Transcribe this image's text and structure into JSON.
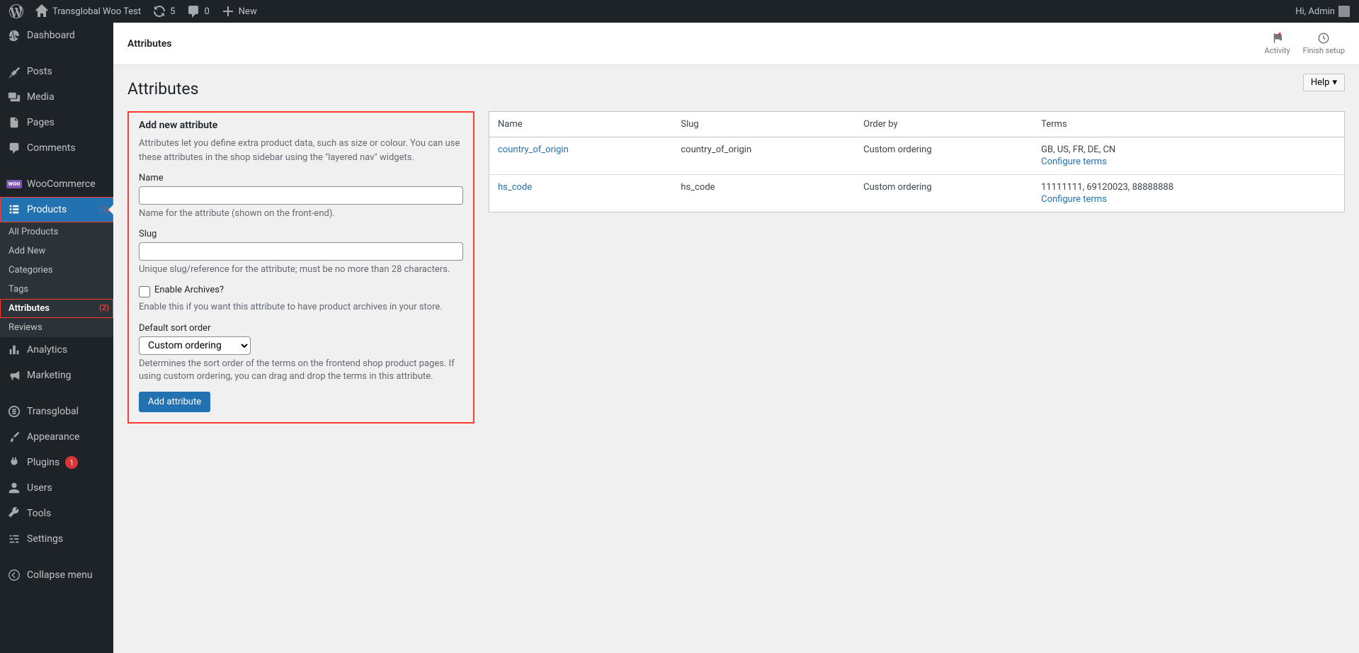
{
  "toolbar": {
    "site_name": "Transglobal Woo Test",
    "updates": "5",
    "comments": "0",
    "new": "New",
    "greeting": "Hi, Admin"
  },
  "sidebar": {
    "dashboard": "Dashboard",
    "posts": "Posts",
    "media": "Media",
    "pages": "Pages",
    "comments": "Comments",
    "woocommerce": "WooCommerce",
    "products": "Products",
    "products_marker": "(1)",
    "sub": {
      "all": "All Products",
      "add": "Add New",
      "categories": "Categories",
      "tags": "Tags",
      "attributes": "Attributes",
      "attributes_marker": "(2)",
      "reviews": "Reviews"
    },
    "analytics": "Analytics",
    "marketing": "Marketing",
    "transglobal": "Transglobal",
    "appearance": "Appearance",
    "plugins": "Plugins",
    "plugins_badge": "1",
    "users": "Users",
    "tools": "Tools",
    "settings": "Settings",
    "collapse": "Collapse menu"
  },
  "topbar": {
    "title": "Attributes",
    "activity": "Activity",
    "finish": "Finish setup"
  },
  "page": {
    "heading": "Attributes",
    "help": "Help"
  },
  "form": {
    "title": "Add new attribute",
    "intro": "Attributes let you define extra product data, such as size or colour. You can use these attributes in the shop sidebar using the \"layered nav\" widgets.",
    "name_label": "Name",
    "name_hint": "Name for the attribute (shown on the front-end).",
    "slug_label": "Slug",
    "slug_hint": "Unique slug/reference for the attribute; must be no more than 28 characters.",
    "archives_label": "Enable Archives?",
    "archives_hint": "Enable this if you want this attribute to have product archives in your store.",
    "sort_label": "Default sort order",
    "sort_option": "Custom ordering",
    "sort_hint": "Determines the sort order of the terms on the frontend shop product pages. If using custom ordering, you can drag and drop the terms in this attribute.",
    "submit": "Add attribute"
  },
  "table": {
    "h_name": "Name",
    "h_slug": "Slug",
    "h_order": "Order by",
    "h_terms": "Terms",
    "rows": [
      {
        "name": "country_of_origin",
        "slug": "country_of_origin",
        "order": "Custom ordering",
        "terms": "GB, US, FR, DE, CN",
        "cfg": "Configure terms"
      },
      {
        "name": "hs_code",
        "slug": "hs_code",
        "order": "Custom ordering",
        "terms": "11111111, 69120023, 88888888",
        "cfg": "Configure terms"
      }
    ]
  }
}
